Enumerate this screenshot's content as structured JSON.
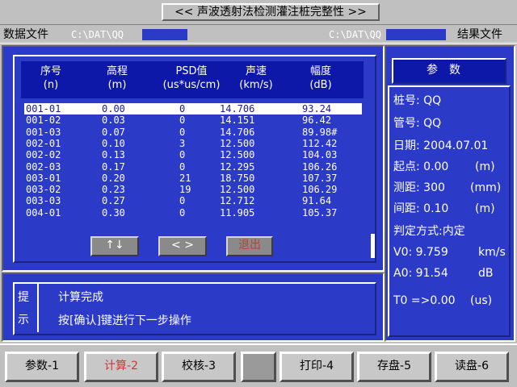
{
  "window": {
    "title": "<< 声波透射法检测灌注桩完整性 >>"
  },
  "filebar": {
    "data_label": "数据文件",
    "data_path": "C:\\DAT\\QQ",
    "result_path": "C:\\DAT\\QQ",
    "result_label": "结果文件"
  },
  "table": {
    "headers": [
      {
        "line1": "序号",
        "line2": "(n)"
      },
      {
        "line1": "高程",
        "line2": "(m)"
      },
      {
        "line1": "PSD值",
        "line2": "(us*us/cm)"
      },
      {
        "line1": "声速",
        "line2": "(km/s)"
      },
      {
        "line1": "幅度",
        "line2": "(dB)"
      }
    ],
    "rows": [
      [
        "001-01",
        "0.00",
        "0",
        "14.706",
        "93.24"
      ],
      [
        "001-02",
        "0.03",
        "0",
        "14.151",
        "96.42"
      ],
      [
        "001-03",
        "0.07",
        "0",
        "14.706",
        "89.98#"
      ],
      [
        "002-01",
        "0.10",
        "3",
        "12.500",
        "112.42"
      ],
      [
        "002-02",
        "0.13",
        "0",
        "12.500",
        "104.03"
      ],
      [
        "002-03",
        "0.17",
        "0",
        "12.295",
        "106.26"
      ],
      [
        "003-01",
        "0.20",
        "21",
        "18.750",
        "107.37"
      ],
      [
        "003-02",
        "0.23",
        "19",
        "12.500",
        "106.29"
      ],
      [
        "003-03",
        "0.27",
        "0",
        "12.712",
        "91.64"
      ],
      [
        "004-01",
        "0.30",
        "0",
        "11.905",
        "105.37"
      ]
    ],
    "selected_row": 0
  },
  "nav": {
    "updown": "↑↓",
    "leftright": "< >",
    "exit": "退出"
  },
  "prompt": {
    "side1": "提",
    "side2": "示",
    "line1": "计算完成",
    "line2": "按[确认]键进行下一步操作"
  },
  "params": {
    "title": "参数",
    "pile_no": "桩号: QQ",
    "tube_no": "管号: QQ",
    "date": "日期: 2004.07.01",
    "start_label": "起点: 0.00",
    "start_unit": "(m)",
    "spacing_label": "测距: 300",
    "spacing_unit": "(mm)",
    "interval_label": "间距: 0.10",
    "interval_unit": "(m)",
    "judge": "判定方式:内定",
    "v0_label": "V0:  9.759",
    "v0_unit": "km/s",
    "a0_label": "A0:  91.54",
    "a0_unit": "dB",
    "t0_label": "T0 =>0.00",
    "t0_unit": "(us)"
  },
  "fkeys": [
    "参数-1",
    "计算-2",
    "校核-3",
    "打印-4",
    "存盘-5",
    "读盘-6"
  ],
  "colors": {
    "panel": "#2b3bc8",
    "header": "#0e18a8",
    "active_key": "#c83a3a"
  }
}
